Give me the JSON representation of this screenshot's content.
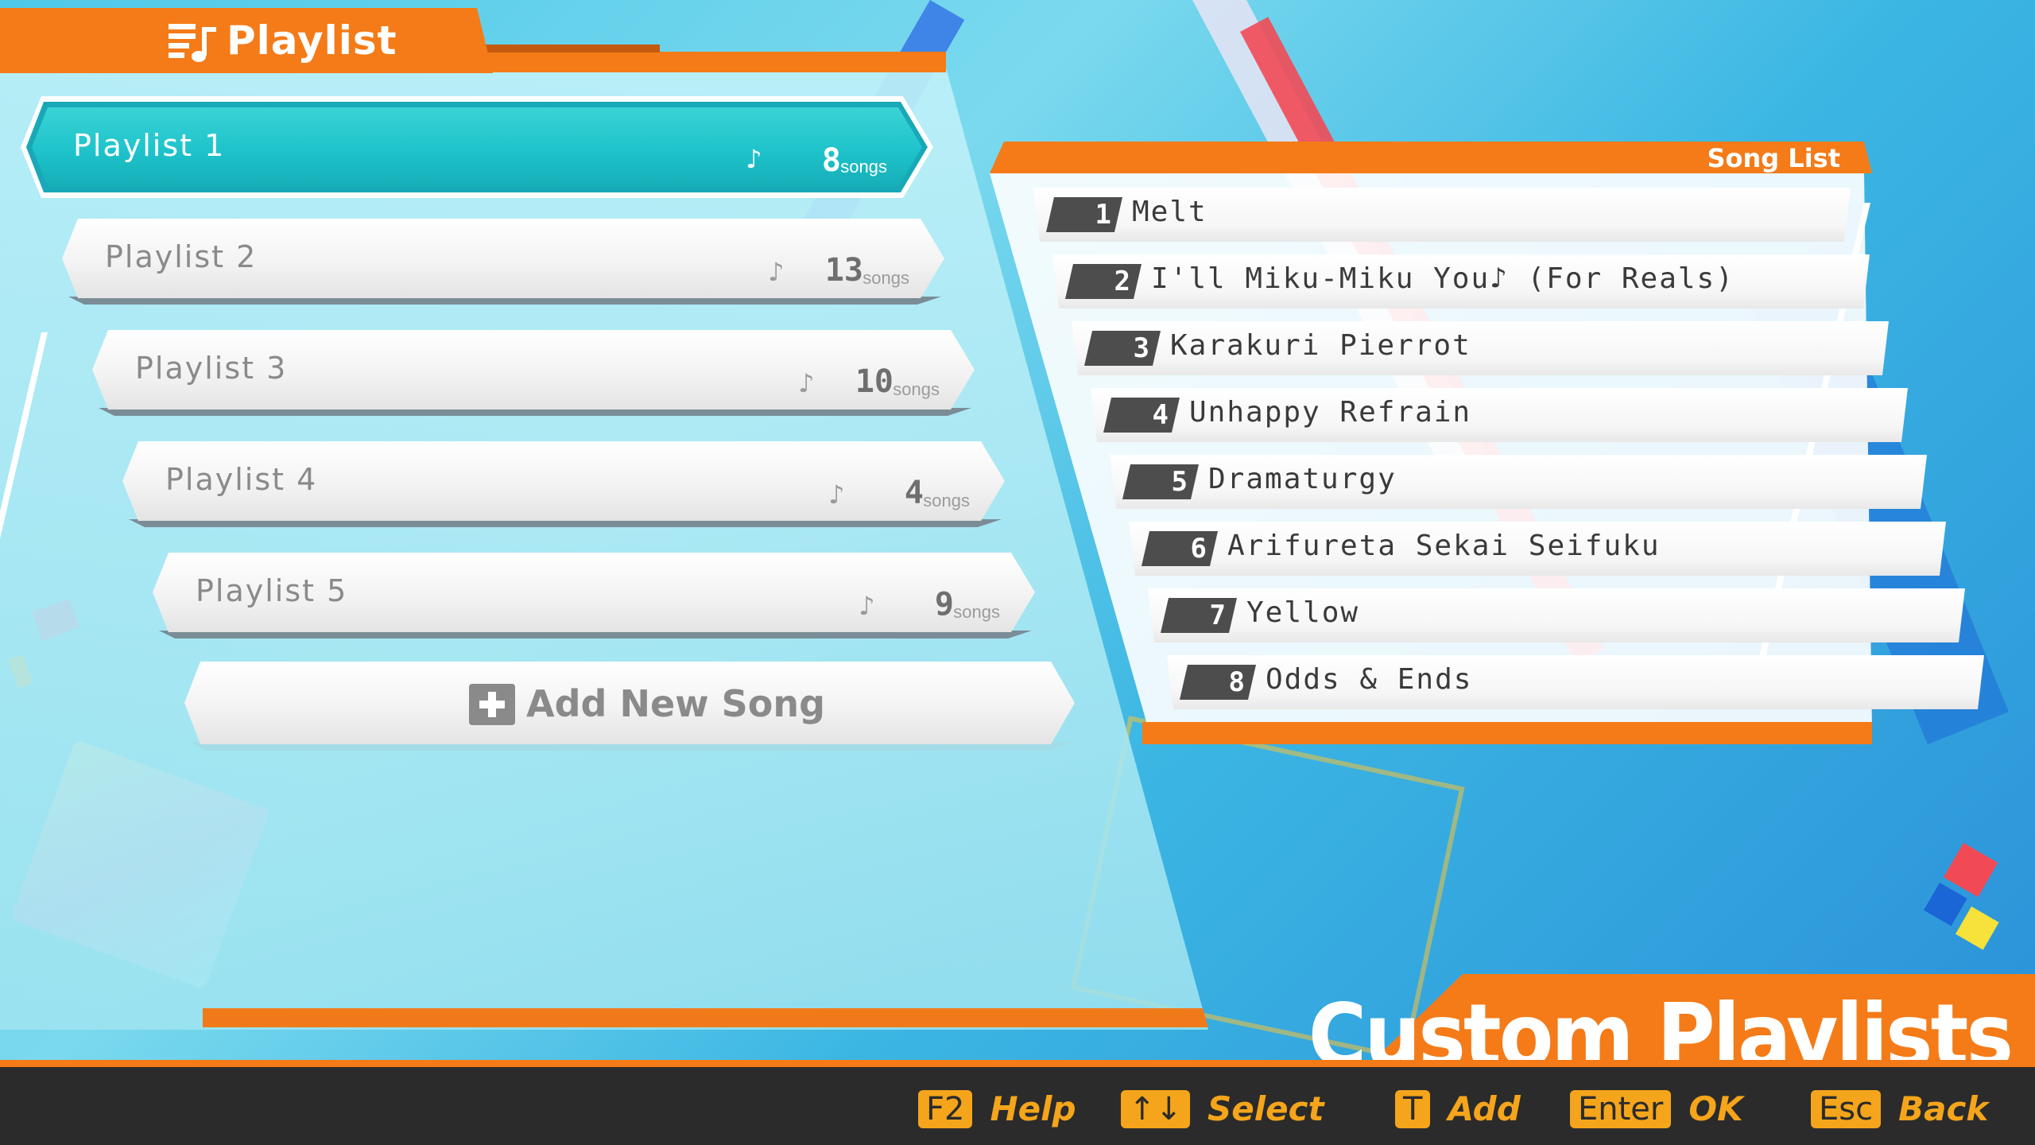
{
  "header": {
    "title": "Playlist"
  },
  "playlists": [
    {
      "name": "Playlist  1",
      "count": "8",
      "unit": "songs",
      "selected": true
    },
    {
      "name": "Playlist  2",
      "count": "13",
      "unit": "songs",
      "selected": false
    },
    {
      "name": "Playlist  3",
      "count": "10",
      "unit": "songs",
      "selected": false
    },
    {
      "name": "Playlist  4",
      "count": "4",
      "unit": "songs",
      "selected": false
    },
    {
      "name": "Playlist  5",
      "count": "9",
      "unit": "songs",
      "selected": false
    }
  ],
  "add_song": {
    "label": "Add New Song"
  },
  "song_list": {
    "title": "Song List",
    "songs": [
      {
        "num": "1",
        "title": "Melt"
      },
      {
        "num": "2",
        "title": "I'll Miku-Miku You♪ (For Reals)"
      },
      {
        "num": "3",
        "title": "Karakuri Pierrot"
      },
      {
        "num": "4",
        "title": "Unhappy Refrain"
      },
      {
        "num": "5",
        "title": "Dramaturgy"
      },
      {
        "num": "6",
        "title": "Arifureta Sekai Seifuku"
      },
      {
        "num": "7",
        "title": "Yellow"
      },
      {
        "num": "8",
        "title": "Odds & Ends"
      }
    ]
  },
  "screen_title": "Custom Playlists",
  "controls": [
    {
      "key": "F2",
      "label": "Help"
    },
    {
      "key": "↑↓",
      "label": "Select"
    },
    {
      "key": "T",
      "label": "Add"
    },
    {
      "key": "Enter",
      "label": "OK"
    },
    {
      "key": "Esc",
      "label": "Back"
    }
  ],
  "colors": {
    "accent_orange": "#f47b18",
    "selected_teal": "#1ec3cb",
    "key_yellow": "#f5a51b",
    "footer_dark": "#2b2b2b"
  }
}
